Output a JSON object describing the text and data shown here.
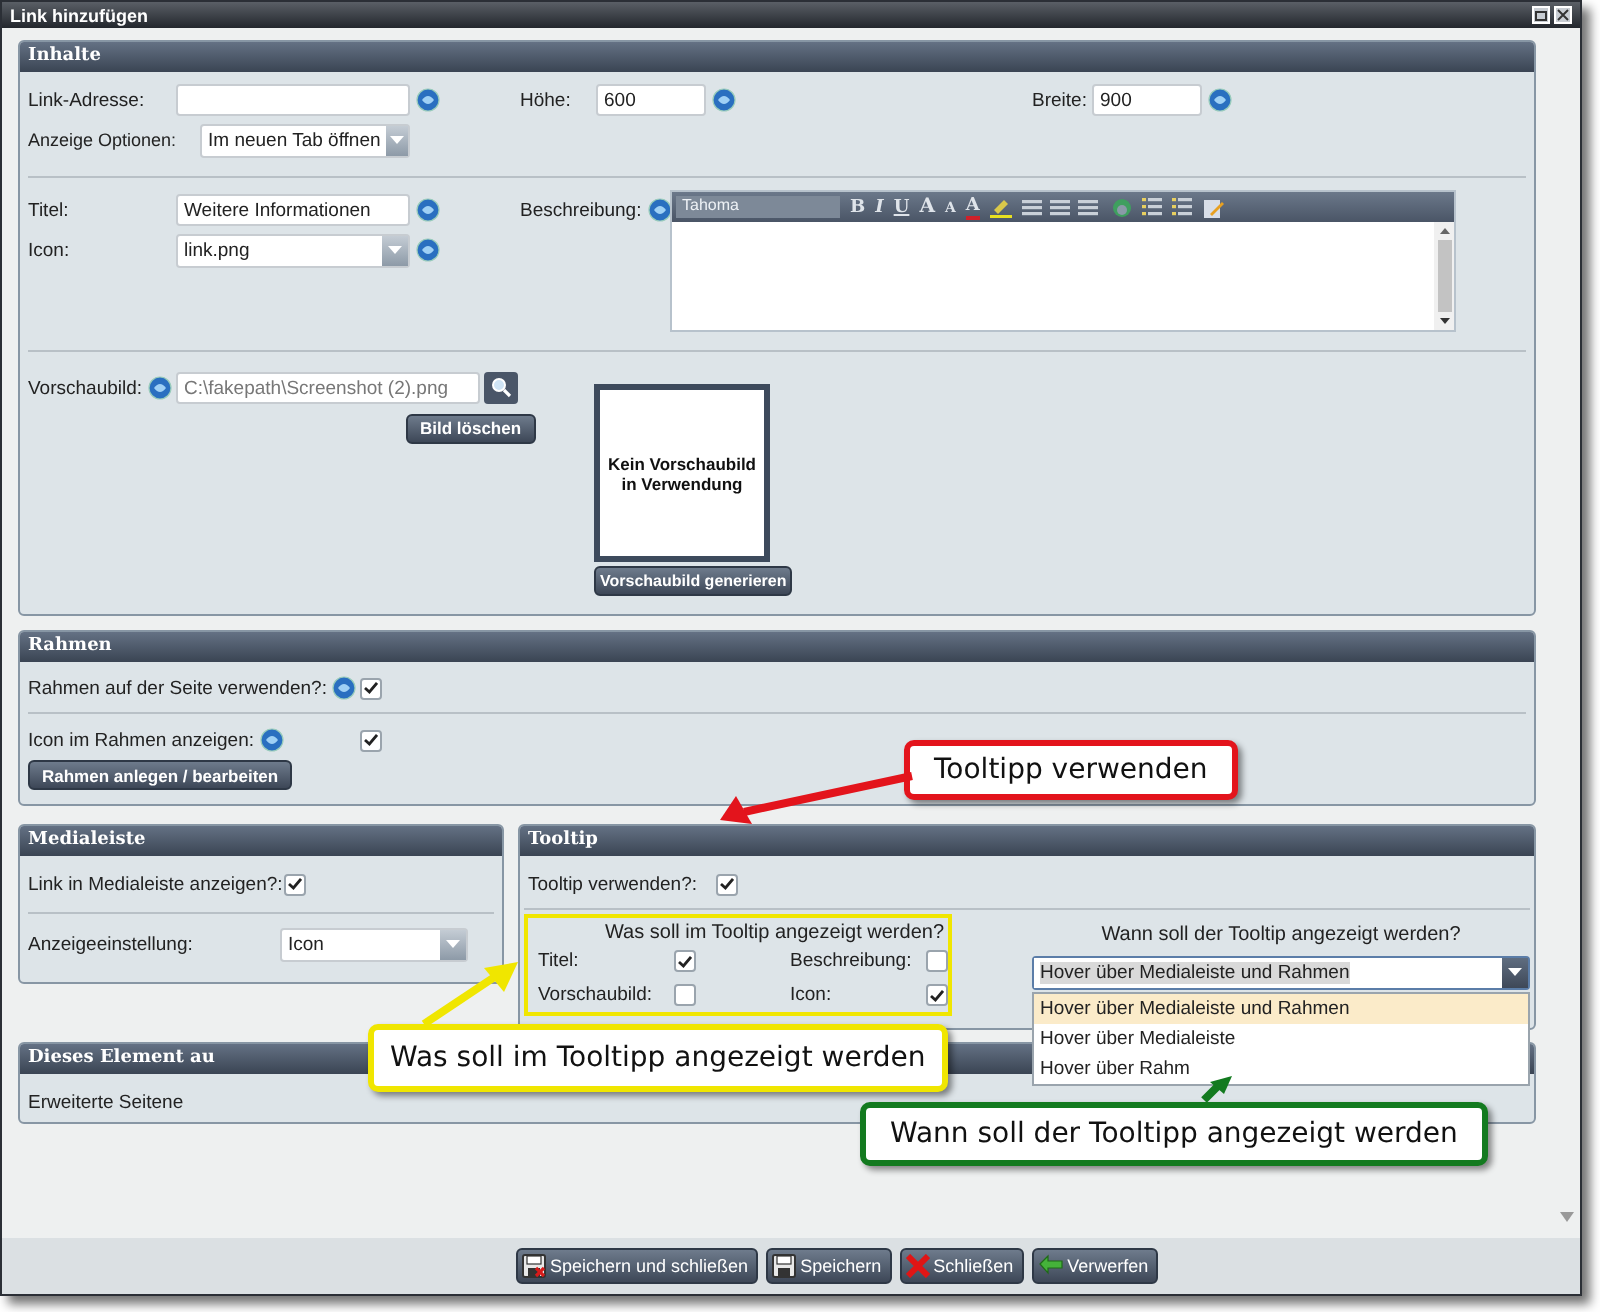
{
  "window": {
    "title": "Link hinzufügen"
  },
  "inhalte": {
    "title": "Inhalte",
    "link_address_label": "Link-Adresse:",
    "height": {
      "label": "Höhe:",
      "value": "600"
    },
    "width": {
      "label": "Breite:",
      "value": "900"
    },
    "display_options": {
      "label": "Anzeige Optionen:",
      "value": "Im neuen Tab öffnen"
    },
    "title_field": {
      "label": "Titel:",
      "value": "Weitere Informationen"
    },
    "icon": {
      "label": "Icon:",
      "value": "link.png"
    },
    "description": {
      "label": "Beschreibung:",
      "font": "Tahoma",
      "format_buttons": [
        {
          "kind": "bold",
          "glyph": "B"
        },
        {
          "kind": "italic",
          "glyph": "I"
        },
        {
          "kind": "underline",
          "glyph": "U"
        },
        {
          "kind": "grow",
          "glyph": "A"
        },
        {
          "kind": "shrink",
          "glyph": "A"
        },
        {
          "kind": "color",
          "glyph": "A"
        }
      ]
    },
    "preview": {
      "label": "Vorschaubild:",
      "value": "C:\\fakepath\\Screenshot (2).png",
      "delete_button": "Bild löschen",
      "empty_text": "Kein Vorschaubild in Verwendung",
      "generate_button": "Vorschaubild generieren"
    }
  },
  "rahmen": {
    "title": "Rahmen",
    "rows": [
      {
        "label": "Rahmen auf der Seite verwenden?:",
        "checked": true
      },
      {
        "label": "Icon im Rahmen anzeigen:",
        "checked": true
      }
    ],
    "button": "Rahmen anlegen / bearbeiten"
  },
  "medialeiste": {
    "title": "Medialeiste",
    "show": {
      "label": "Link in Medialeiste anzeigen?:",
      "checked": true
    },
    "setting": {
      "label": "Anzeigeeinstellung:",
      "value": "Icon"
    }
  },
  "tooltip": {
    "title": "Tooltip",
    "use": {
      "label": "Tooltip verwenden?:",
      "checked": true
    },
    "what": {
      "heading": "Was soll im Tooltip angezeigt werden?",
      "options": [
        {
          "label": "Titel:",
          "checked": true
        },
        {
          "label": "Beschreibung:",
          "checked": false
        },
        {
          "label": "Vorschaubild:",
          "checked": false
        },
        {
          "label": "Icon:",
          "checked": true
        }
      ]
    },
    "when": {
      "heading": "Wann soll der Tooltip angezeigt werden?",
      "value": "Hover über Medialeiste und Rahmen",
      "expanded": true,
      "options": [
        {
          "label": "Hover über Medialeiste und Rahmen",
          "selected": true
        },
        {
          "label": "Hover über Medialeiste",
          "selected": false
        },
        {
          "label": "Hover über Rahm",
          "selected": false
        }
      ]
    }
  },
  "element_section": {
    "title": "Dieses Element au",
    "row_label": "Erweiterte Seitene"
  },
  "buttons": [
    {
      "label": "Speichern und schließen",
      "kind": "save-close"
    },
    {
      "label": "Speichern",
      "kind": "save"
    },
    {
      "label": "Schließen",
      "kind": "close"
    },
    {
      "label": "Verwerfen",
      "kind": "discard"
    }
  ],
  "annotations": [
    {
      "text": "Tooltipp verwenden",
      "color": "#e3141c"
    },
    {
      "text": "Was soll im Tooltipp angezeigt werden",
      "color": "#f0e600"
    },
    {
      "text": "Wann soll der Tooltipp angezeigt werden",
      "color": "#137a1f"
    }
  ]
}
